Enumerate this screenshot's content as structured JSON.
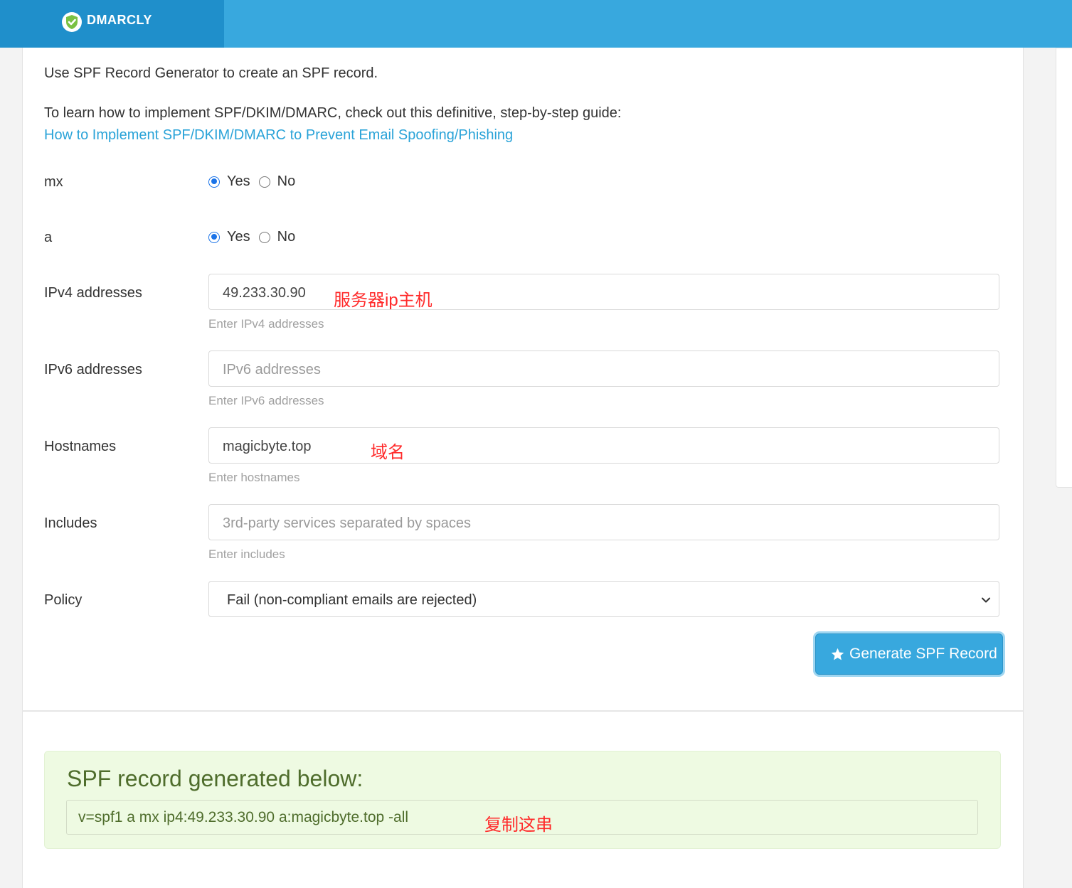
{
  "header": {
    "brand_name": "DMARCLY",
    "logo_icon": "shield-check-icon",
    "colors": {
      "bar": "#38a8de",
      "brand_bg": "#1f8fcb"
    }
  },
  "intro": {
    "line1": "Use SPF Record Generator to create an SPF record.",
    "line2": "To learn how to implement SPF/DKIM/DMARC, check out this definitive, step-by-step guide:",
    "guide_link": "How to Implement SPF/DKIM/DMARC to Prevent Email Spoofing/Phishing"
  },
  "form": {
    "mx": {
      "label": "mx",
      "options": [
        "Yes",
        "No"
      ],
      "selected": "Yes"
    },
    "a": {
      "label": "a",
      "options": [
        "Yes",
        "No"
      ],
      "selected": "Yes"
    },
    "ipv4": {
      "label": "IPv4 addresses",
      "value": "49.233.30.90",
      "help": "Enter IPv4 addresses",
      "annotation": "服务器ip主机"
    },
    "ipv6": {
      "label": "IPv6 addresses",
      "placeholder": "IPv6 addresses",
      "help": "Enter IPv6 addresses"
    },
    "hostnames": {
      "label": "Hostnames",
      "value": "magicbyte.top",
      "help": "Enter hostnames",
      "annotation": "域名"
    },
    "includes": {
      "label": "Includes",
      "placeholder": "3rd-party services separated by spaces",
      "help": "Enter includes"
    },
    "policy": {
      "label": "Policy",
      "selected": "Fail (non-compliant emails are rejected)"
    },
    "generate_button": "Generate SPF Record"
  },
  "result": {
    "title": "SPF record generated below:",
    "record": "v=spf1 a mx ip4:49.233.30.90 a:magicbyte.top -all",
    "annotation": "复制这串",
    "colors": {
      "bg": "#eefae2",
      "text": "#4f6d2c"
    }
  }
}
